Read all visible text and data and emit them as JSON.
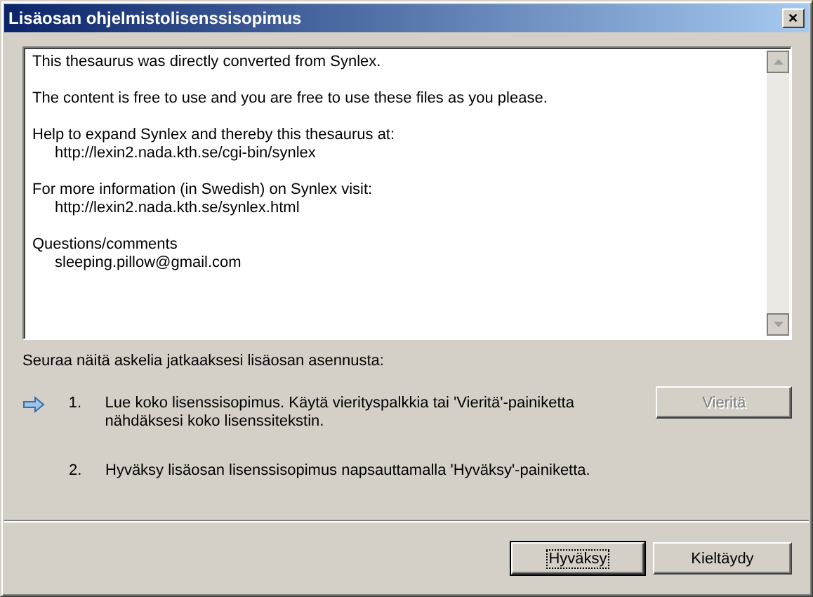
{
  "window": {
    "title": "Lisäosan ohjelmistolisenssisopimus",
    "close_glyph": "✕"
  },
  "license_text": [
    {
      "lines": [
        {
          "kind": "plain",
          "text": "This thesaurus was directly converted from Synlex."
        }
      ]
    },
    {
      "lines": [
        {
          "kind": "plain",
          "text": "The content is free to use and you are free to use these files as you please."
        }
      ]
    },
    {
      "lines": [
        {
          "kind": "plain",
          "text": "Help to expand Synlex and thereby this thesaurus at:"
        },
        {
          "kind": "indented",
          "text": "http://lexin2.nada.kth.se/cgi-bin/synlex"
        }
      ]
    },
    {
      "lines": [
        {
          "kind": "plain",
          "text": "For more information (in Swedish) on Synlex visit:"
        },
        {
          "kind": "indented",
          "text": "http://lexin2.nada.kth.se/synlex.html"
        }
      ]
    },
    {
      "lines": [
        {
          "kind": "plain",
          "text": "Questions/comments"
        },
        {
          "kind": "indented",
          "text": "sleeping.pillow@gmail.com"
        }
      ]
    }
  ],
  "instructions": "Seuraa näitä askelia jatkaaksesi lisäosan asennusta:",
  "steps": [
    {
      "number": "1.",
      "text": "Lue koko lisenssisopimus. Käytä vierityspalkkia tai 'Vieritä'-painiketta nähdäksesi koko lisenssitekstin.",
      "current": true,
      "button": {
        "label": "Vieritä",
        "disabled": true
      }
    },
    {
      "number": "2.",
      "text": "Hyväksy lisäosan lisenssisopimus napsauttamalla 'Hyväksy'-painiketta.",
      "current": false
    }
  ],
  "buttons": [
    {
      "label": "Hyväksy",
      "default": true,
      "disabled": false
    },
    {
      "label": "Kieltäydy",
      "default": false,
      "disabled": false
    }
  ]
}
